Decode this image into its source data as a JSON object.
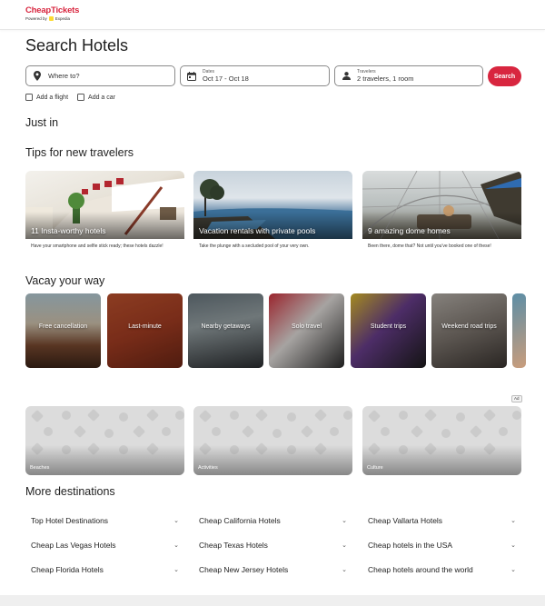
{
  "header": {
    "brand": "CheapTickets",
    "powered_by": "Powered by",
    "partner": "Expedia"
  },
  "page_title": "Search Hotels",
  "search": {
    "where_placeholder": "Where to?",
    "dates_label": "Dates",
    "dates_value": "Oct 17 - Oct 18",
    "travelers_label": "Travelers",
    "travelers_value": "2 travelers, 1 room",
    "button_label": "Search",
    "add_flight": "Add a flight",
    "add_car": "Add a car"
  },
  "sections": {
    "just_in": "Just in",
    "tips": "Tips for new travelers",
    "vacay": "Vacay your way",
    "more_destinations": "More destinations"
  },
  "tips": [
    {
      "title": "11 Insta-worthy hotels",
      "desc": "Have your smartphone and selfie stick ready; these hotels dazzle!"
    },
    {
      "title": "Vacation rentals with private pools",
      "desc": "Take the plunge with a secluded pool of your very own."
    },
    {
      "title": "9 amazing dome homes",
      "desc": "Been there, dome that? Not until you've booked one of these!"
    }
  ],
  "vacay": [
    {
      "label": "Free cancellation"
    },
    {
      "label": "Last-minute"
    },
    {
      "label": "Nearby getaways"
    },
    {
      "label": "Solo travel"
    },
    {
      "label": "Student trips"
    },
    {
      "label": "Weekend road trips"
    }
  ],
  "ad_label": "Ad",
  "categories": [
    "Beaches",
    "Activities",
    "Culture"
  ],
  "destinations": [
    [
      "Top Hotel Destinations",
      "Cheap California Hotels",
      "Cheap Vallarta Hotels"
    ],
    [
      "Cheap Las Vegas Hotels",
      "Cheap Texas Hotels",
      "Cheap hotels in the USA"
    ],
    [
      "Cheap Florida Hotels",
      "Cheap New Jersey Hotels",
      "Cheap hotels around the world"
    ]
  ],
  "icons": {
    "where": "map-pin-icon",
    "dates": "calendar-icon",
    "travelers": "person-icon",
    "chevron": "chevron-down-icon"
  },
  "colors": {
    "brand_red": "#d8263f",
    "partner_yellow": "#fddb32"
  }
}
